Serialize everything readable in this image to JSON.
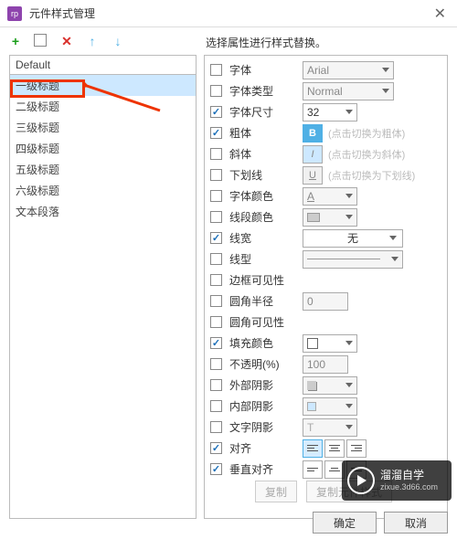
{
  "window": {
    "title": "元件样式管理"
  },
  "toolbar": {
    "instruction": "选择属性进行样式替换。"
  },
  "styles": {
    "default_label": "Default",
    "items": [
      "一级标题",
      "二级标题",
      "三级标题",
      "四级标题",
      "五级标题",
      "六级标题",
      "文本段落"
    ],
    "selected_index": 0
  },
  "props": {
    "font": {
      "label": "字体",
      "checked": false,
      "value": "Arial"
    },
    "font_type": {
      "label": "字体类型",
      "checked": false,
      "value": "Normal"
    },
    "font_size": {
      "label": "字体尺寸",
      "checked": true,
      "value": "32"
    },
    "bold": {
      "label": "粗体",
      "checked": true,
      "icon": "B",
      "hint": "(点击切换为粗体)"
    },
    "italic": {
      "label": "斜体",
      "checked": false,
      "icon": "I",
      "hint": "(点击切换为斜体)"
    },
    "underline": {
      "label": "下划线",
      "checked": false,
      "icon": "U",
      "hint": "(点击切换为下划线)"
    },
    "font_color": {
      "label": "字体颜色",
      "checked": false
    },
    "segment_color": {
      "label": "线段颜色",
      "checked": false
    },
    "line_width": {
      "label": "线宽",
      "checked": true,
      "value": "无"
    },
    "line_style": {
      "label": "线型",
      "checked": false
    },
    "border_vis": {
      "label": "边框可见性",
      "checked": false
    },
    "corner_radius": {
      "label": "圆角半径",
      "checked": false,
      "value": "0"
    },
    "corner_vis": {
      "label": "圆角可见性",
      "checked": false
    },
    "fill_color": {
      "label": "填充颜色",
      "checked": true
    },
    "opacity": {
      "label": "不透明(%)",
      "checked": false,
      "value": "100"
    },
    "outer_shadow": {
      "label": "外部阴影",
      "checked": false
    },
    "inner_shadow": {
      "label": "内部阴影",
      "checked": false
    },
    "text_shadow": {
      "label": "文字阴影",
      "checked": false
    },
    "align": {
      "label": "对齐",
      "checked": true
    },
    "valign": {
      "label": "垂直对齐",
      "checked": true
    }
  },
  "copybar": {
    "copy": "复制",
    "copy_style": "复制元件样式"
  },
  "footer": {
    "ok": "确定",
    "cancel": "取消"
  },
  "watermark": {
    "brand": "溜溜自学",
    "url": "zixue.3d66.com"
  }
}
